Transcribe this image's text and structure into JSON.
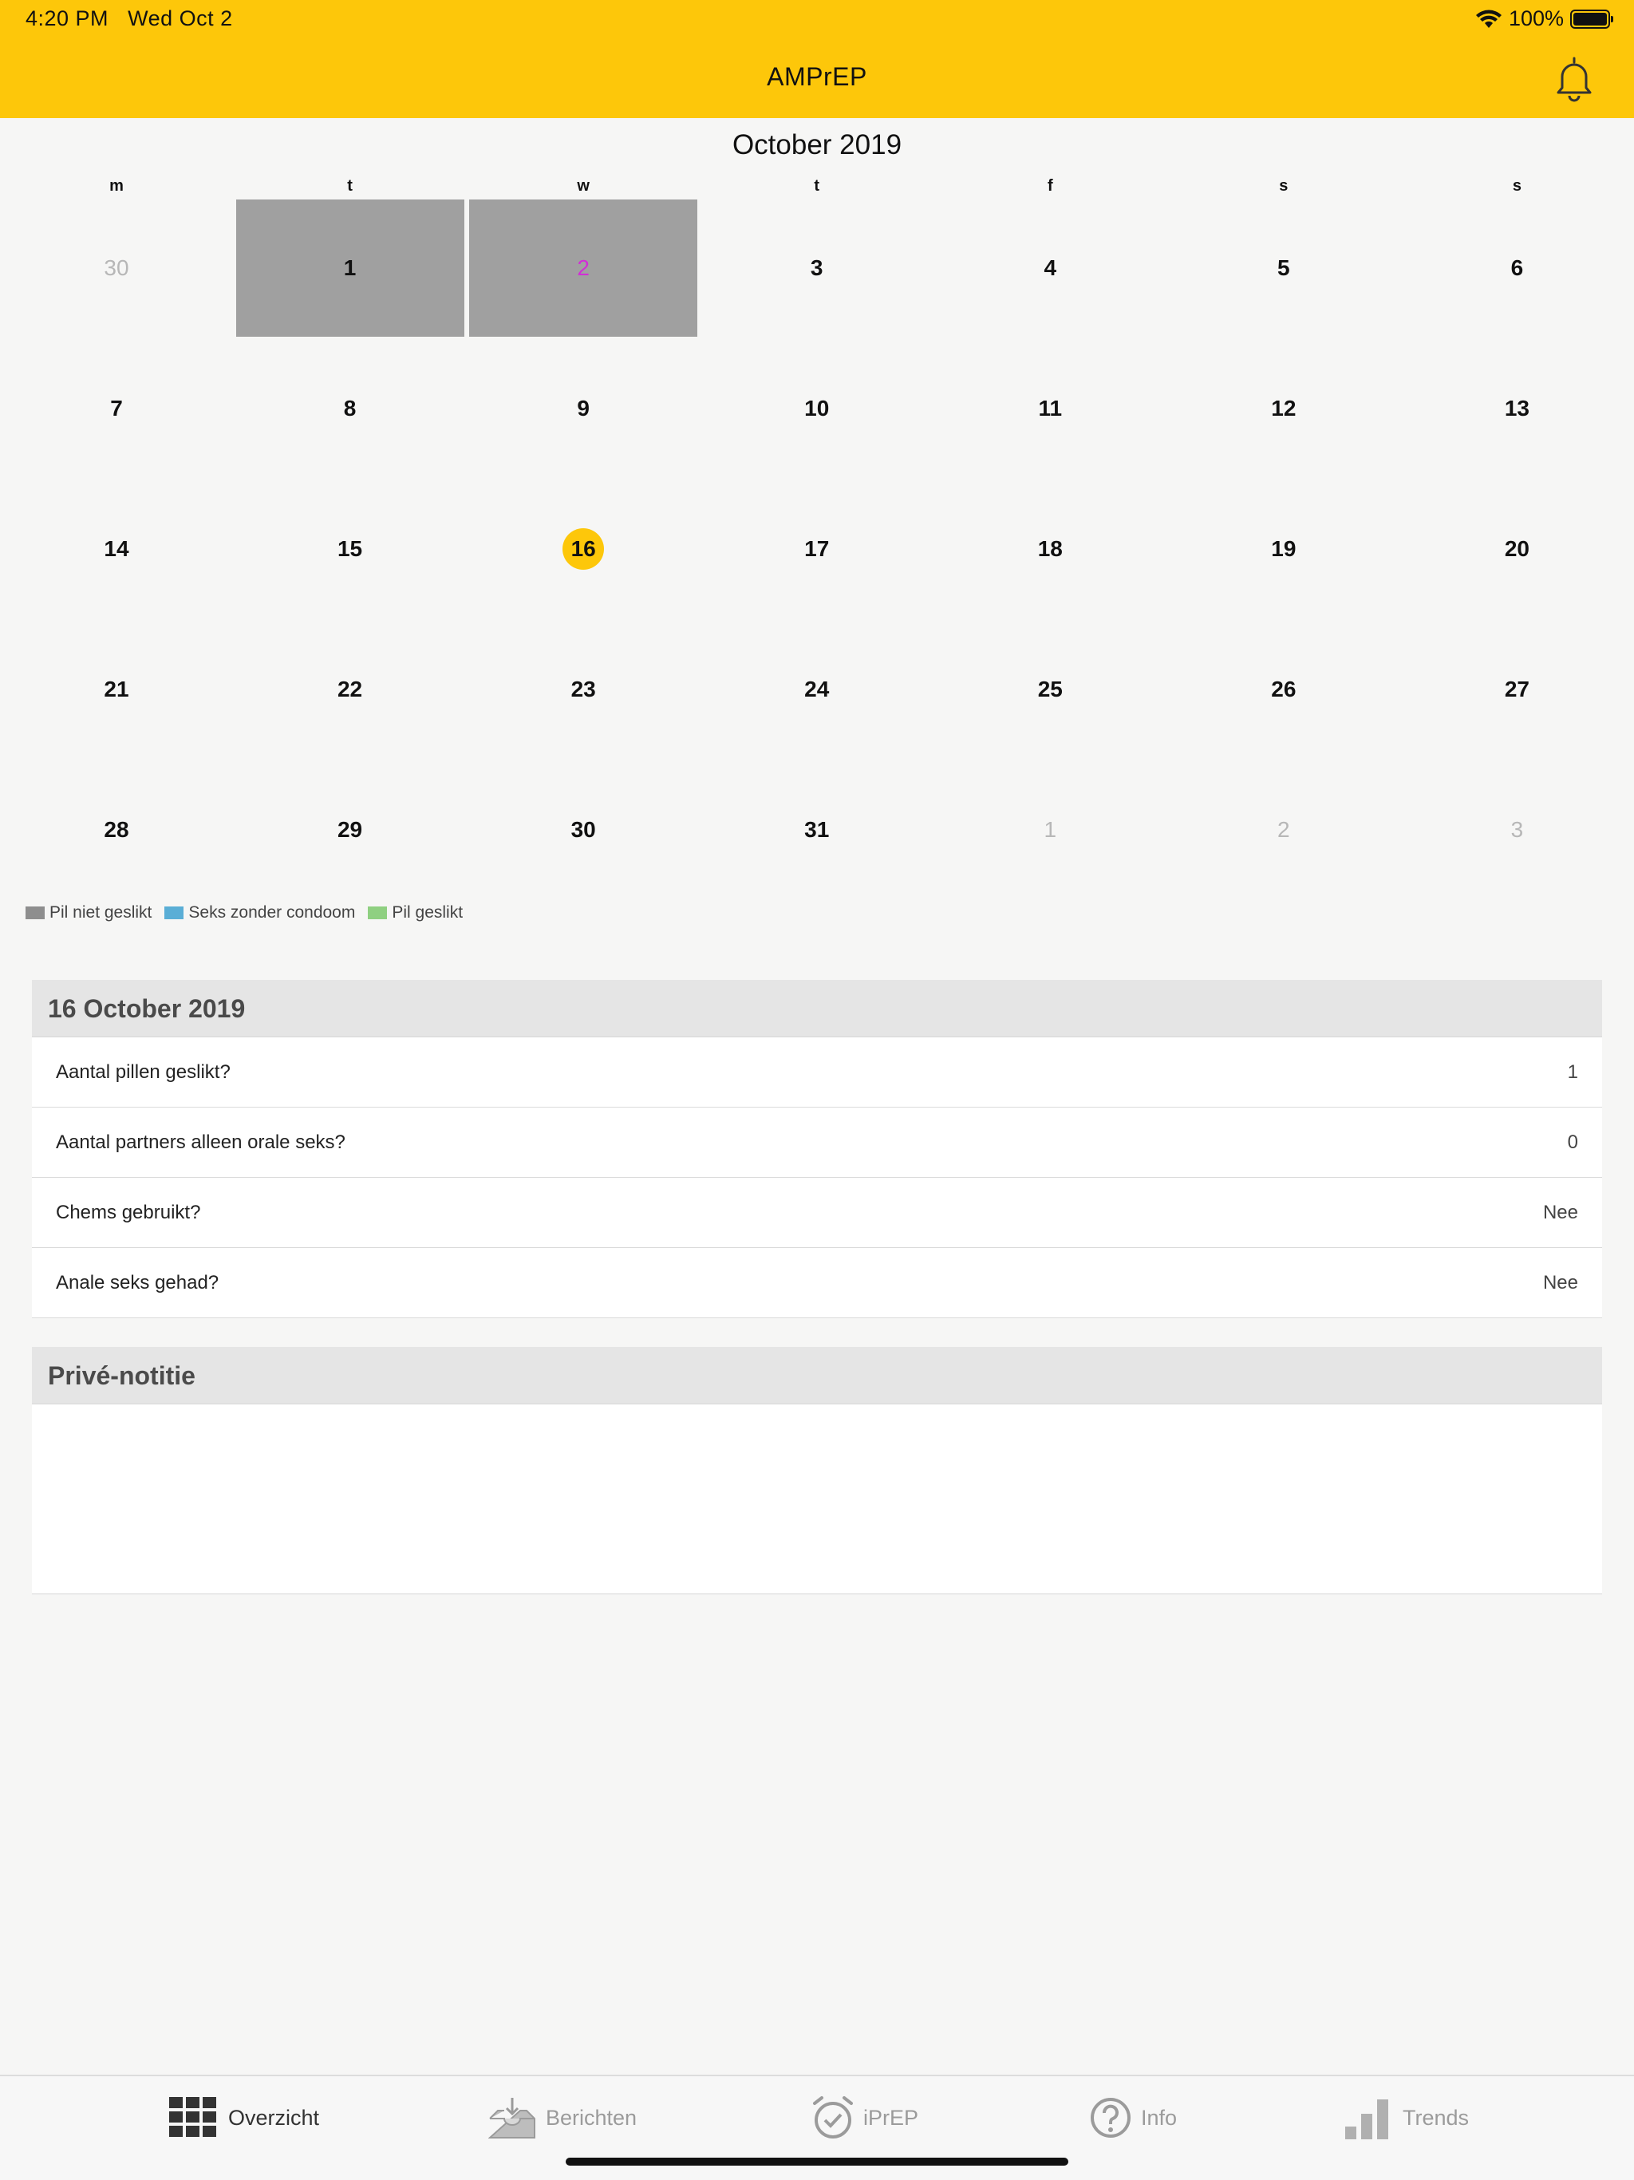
{
  "status": {
    "time": "4:20 PM",
    "date": "Wed Oct 2",
    "battery": "100%"
  },
  "header": {
    "title": "AMPrEP"
  },
  "calendar": {
    "month": "October 2019",
    "weekdays": [
      "m",
      "t",
      "w",
      "t",
      "f",
      "s",
      "s"
    ],
    "weeks": [
      [
        {
          "d": "30",
          "muted": true
        },
        {
          "d": "1",
          "shaded": true
        },
        {
          "d": "2",
          "shaded": true,
          "accent": true
        },
        {
          "d": "3"
        },
        {
          "d": "4"
        },
        {
          "d": "5"
        },
        {
          "d": "6"
        }
      ],
      [
        {
          "d": "7"
        },
        {
          "d": "8"
        },
        {
          "d": "9"
        },
        {
          "d": "10"
        },
        {
          "d": "11"
        },
        {
          "d": "12"
        },
        {
          "d": "13"
        }
      ],
      [
        {
          "d": "14"
        },
        {
          "d": "15"
        },
        {
          "d": "16",
          "today": true
        },
        {
          "d": "17"
        },
        {
          "d": "18"
        },
        {
          "d": "19"
        },
        {
          "d": "20"
        }
      ],
      [
        {
          "d": "21"
        },
        {
          "d": "22"
        },
        {
          "d": "23"
        },
        {
          "d": "24"
        },
        {
          "d": "25"
        },
        {
          "d": "26"
        },
        {
          "d": "27"
        }
      ],
      [
        {
          "d": "28"
        },
        {
          "d": "29"
        },
        {
          "d": "30"
        },
        {
          "d": "31"
        },
        {
          "d": "1",
          "muted": true
        },
        {
          "d": "2",
          "muted": true
        },
        {
          "d": "3",
          "muted": true
        }
      ]
    ]
  },
  "legend": [
    {
      "label": "Pil niet geslikt",
      "color": "#8e8e8e"
    },
    {
      "label": "Seks zonder condoom",
      "color": "#5aaed6"
    },
    {
      "label": "Pil geslikt",
      "color": "#8fd081"
    }
  ],
  "detail": {
    "title": "16 October 2019",
    "rows": [
      {
        "label": "Aantal pillen geslikt?",
        "value": "1"
      },
      {
        "label": "Aantal partners alleen orale seks?",
        "value": "0"
      },
      {
        "label": "Chems gebruikt?",
        "value": "Nee"
      },
      {
        "label": "Anale seks gehad?",
        "value": "Nee"
      }
    ]
  },
  "note": {
    "title": "Privé-notitie"
  },
  "tabs": [
    {
      "label": "Overzicht",
      "icon": "grid-icon",
      "active": true
    },
    {
      "label": "Berichten",
      "icon": "inbox-icon"
    },
    {
      "label": "iPrEP",
      "icon": "alarm-check-icon"
    },
    {
      "label": "Info",
      "icon": "question-circle-icon"
    },
    {
      "label": "Trends",
      "icon": "bar-chart-icon"
    }
  ]
}
